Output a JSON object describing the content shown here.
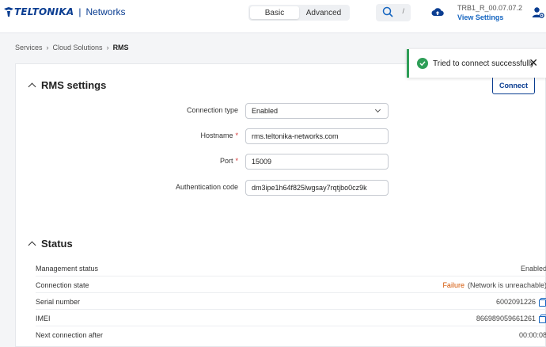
{
  "header": {
    "logo_text": "TELTONIKA",
    "logo_sub": "Networks",
    "modes": [
      "Basic",
      "Advanced"
    ],
    "active_mode": "Basic",
    "search_shortcut": "/",
    "device_name": "TRB1_R_00.07.07.2",
    "view_settings": "View Settings",
    "icons": [
      "search-icon",
      "cloud-upload-icon",
      "user-settings-icon"
    ]
  },
  "breadcrumb": [
    "Services",
    "Cloud Solutions",
    "RMS"
  ],
  "toast": {
    "message": "Tried to connect successfully",
    "close": "✕"
  },
  "rms": {
    "title": "RMS settings",
    "connect_label": "Connect",
    "fields": {
      "connection_type": {
        "label": "Connection type",
        "value": "Enabled"
      },
      "hostname": {
        "label": "Hostname",
        "value": "rms.teltonika-networks.com",
        "required": "*"
      },
      "port": {
        "label": "Port",
        "value": "15009",
        "required": "*"
      },
      "auth_code": {
        "label": "Authentication code",
        "value": "dm3ipe1h64f825lwgsay7rqtjbo0cz9k"
      }
    }
  },
  "status": {
    "title": "Status",
    "rows": [
      {
        "label": "Management status",
        "value": "Enabled"
      },
      {
        "label": "Connection state",
        "value_status": "Failure",
        "value_detail": "(Network is unreachable)"
      },
      {
        "label": "Serial number",
        "value": "6002091226"
      },
      {
        "label": "IMEI",
        "value": "866989059661261"
      },
      {
        "label": "Next connection after",
        "value": "00:00:08"
      }
    ]
  },
  "colors": {
    "brand": "#0a3d91",
    "link": "#1565c0",
    "success": "#2e9e57",
    "failure": "#d35400",
    "required": "#d32f2f"
  }
}
